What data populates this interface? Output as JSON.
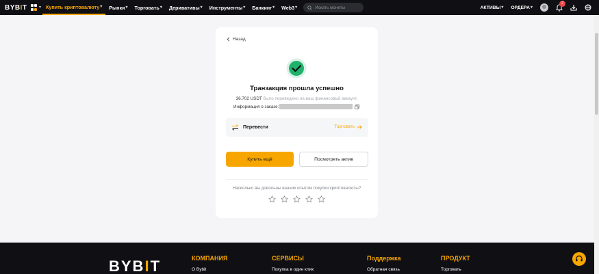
{
  "header": {
    "logo": {
      "main": "BYB",
      "accent": "I",
      "tail": "T"
    },
    "nav": [
      {
        "label": "Купить криптовалюту",
        "active": true
      },
      {
        "label": "Рынки",
        "active": false
      },
      {
        "label": "Торговать",
        "active": false
      },
      {
        "label": "Деривативы",
        "active": false
      },
      {
        "label": "Инструменты",
        "active": false
      },
      {
        "label": "Банкинг",
        "active": false
      },
      {
        "label": "Web3",
        "active": false
      }
    ],
    "search_placeholder": "Искать монеты",
    "assets_label": "АКТИВЫ",
    "orders_label": "ОРДЕРА",
    "notification_count": "2"
  },
  "main": {
    "back_label": "Назад",
    "title": "Транзакция прошла успешно",
    "amount": "36.702 USDT",
    "transferred_text": "было переведено на ваш финансовый аккаунт.",
    "order_info_label": "Информация о заказе:",
    "transfer_label": "Перевести",
    "trade_link_label": "Торговать",
    "buy_more_label": "Купить ещё",
    "view_assets_label": "Посмотреть актив",
    "rating_question": "Насколько вы довольны вашим опытом покупки криптовалюты?",
    "star_count": 5
  },
  "footer": {
    "logo": {
      "main": "BYB",
      "accent": "I",
      "tail": "T"
    },
    "columns": [
      {
        "heading": "КОМПАНИЯ",
        "first_link": "О Bybit"
      },
      {
        "heading": "СЕРВИСЫ",
        "first_link": "Покупка в один клик"
      },
      {
        "heading": "Поддержка",
        "first_link": "Обратная связь"
      },
      {
        "heading": "ПРОДУКТ",
        "first_link": "Торговать"
      }
    ]
  },
  "colors": {
    "accent": "#f7a600",
    "success": "#20b26c",
    "header_bg": "#101014"
  },
  "icons": [
    "grid-icon",
    "search-icon",
    "bell-icon",
    "download-icon",
    "globe-icon",
    "chevron-left-icon",
    "check-circle-icon",
    "copy-icon",
    "transfer-icon",
    "arrow-right-icon",
    "star-icon",
    "headset-icon"
  ]
}
